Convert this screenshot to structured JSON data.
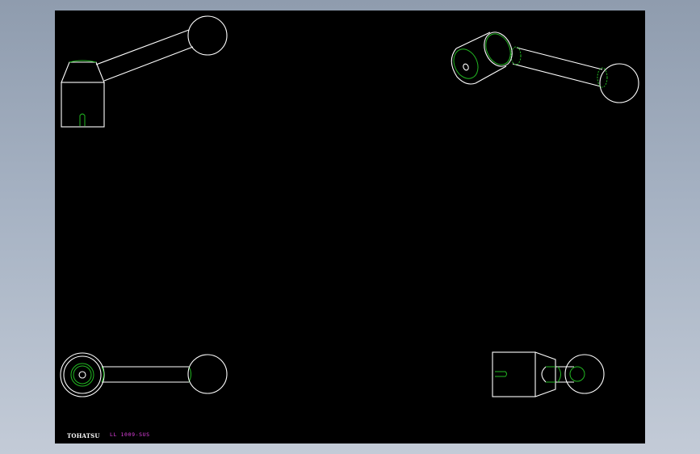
{
  "title_block": {
    "brand": "TOHATSU",
    "part_number": "LL 1009-SUS"
  },
  "colors": {
    "background": "#9aa6b8",
    "sheet": "#000000",
    "outline": "#ffffff",
    "hidden_lines": "#22b822",
    "annotation": "#e040e0"
  },
  "views": [
    "isometric-view",
    "rotated-isometric-view",
    "end-view",
    "side-view"
  ]
}
